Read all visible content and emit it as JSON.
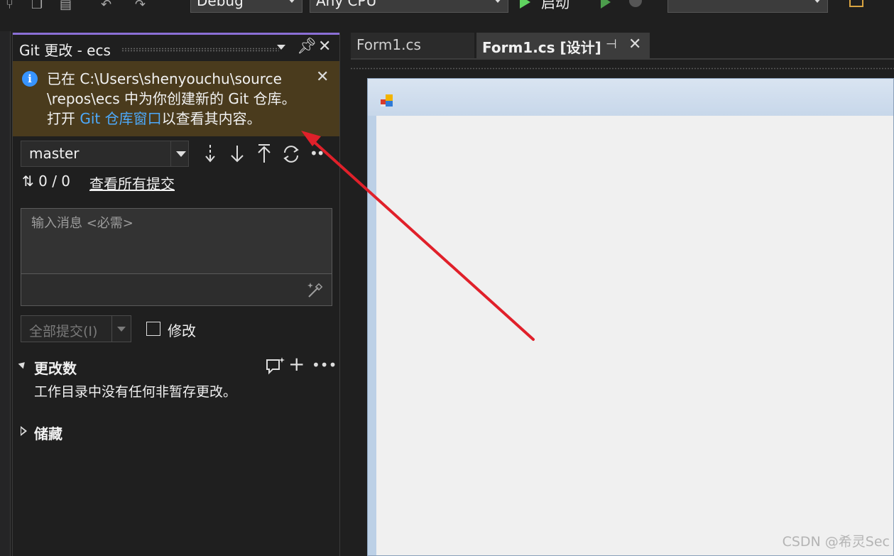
{
  "toolbar": {
    "config_value": "Debug",
    "platform_value": "Any CPU",
    "start_label": "启动"
  },
  "git_panel": {
    "title": "Git 更改 - ecs",
    "info": {
      "line1": "已在 C:\\Users\\shenyouchu\\source",
      "line2": "\\repos\\ecs 中为你创建新的 Git 仓库。",
      "line3_prefix": "打开 ",
      "link": "Git 仓库窗口",
      "line3_suffix": "以查看其内容。"
    },
    "branch": "master",
    "counts": "0 / 0",
    "view_all_commits": "查看所有提交",
    "message_placeholder": "输入消息 <必需>",
    "commit_all_label": "全部提交(I)",
    "amend_label": "修改",
    "changes": {
      "title": "更改数",
      "description": "工作目录中没有任何非暂存更改。"
    },
    "stash_title": "储藏"
  },
  "tabs": [
    {
      "label": "Form1.cs",
      "active": false
    },
    {
      "label": "Form1.cs [设计]",
      "active": true
    }
  ],
  "watermark": "CSDN @希灵Sec",
  "colors": {
    "accent": "#8b6fd6",
    "info_bg": "#4a3b1d",
    "link": "#4daafc",
    "annotation_arrow": "#e0202a"
  }
}
